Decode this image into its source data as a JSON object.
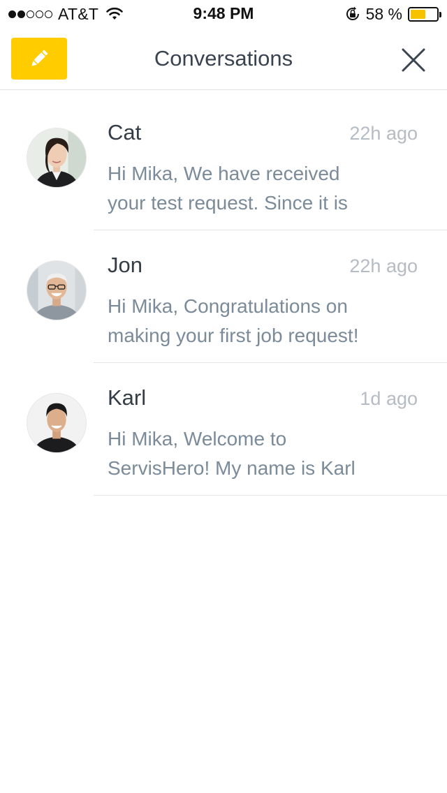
{
  "status_bar": {
    "carrier": "AT&T",
    "signal_filled": 2,
    "signal_total": 5,
    "time": "9:48 PM",
    "battery_percent_text": "58 %",
    "battery_level": 0.58,
    "battery_color": "#f7c300",
    "icons": [
      "wifi-icon",
      "orientation-lock-icon",
      "battery-icon"
    ]
  },
  "nav": {
    "title": "Conversations",
    "compose_icon": "pencil-icon",
    "compose_color": "#ffcc00",
    "close_icon": "close-icon"
  },
  "conversations": [
    {
      "name": "Cat",
      "time": "22h ago",
      "preview_line1": "Hi Mika, We have received",
      "preview_line2": "your test request. Since it is"
    },
    {
      "name": "Jon",
      "time": "22h ago",
      "preview_line1": "Hi Mika, Congratulations on",
      "preview_line2": "making your first job request!"
    },
    {
      "name": "Karl",
      "time": "1d ago",
      "preview_line1": "Hi Mika, Welcome to",
      "preview_line2": "ServisHero! My name is Karl"
    }
  ]
}
